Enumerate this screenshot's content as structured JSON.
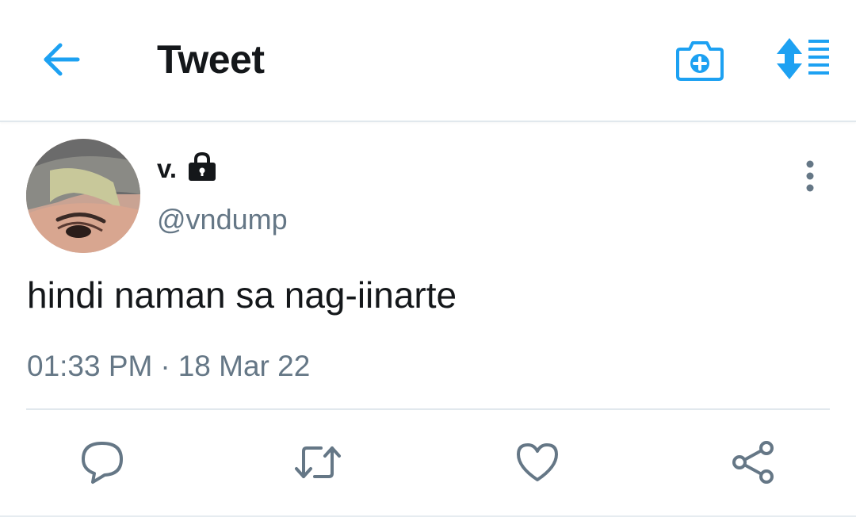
{
  "header": {
    "title": "Tweet",
    "icons": {
      "back": "back-arrow-icon",
      "camera": "camera-add-icon",
      "sort": "sort-lines-icon"
    },
    "accent_color": "#1da1f2"
  },
  "tweet": {
    "display_name": "v.",
    "protected": true,
    "handle": "@vndump",
    "text": "hindi naman sa nag-iinarte",
    "time": "01:33 PM",
    "separator": "·",
    "date": "18 Mar 22"
  },
  "actions": [
    {
      "name": "reply",
      "icon": "reply-icon"
    },
    {
      "name": "retweet",
      "icon": "retweet-icon"
    },
    {
      "name": "like",
      "icon": "heart-icon"
    },
    {
      "name": "share",
      "icon": "share-icon"
    }
  ],
  "colors": {
    "text_primary": "#14171a",
    "text_secondary": "#657786",
    "divider": "#e1e8ed"
  }
}
